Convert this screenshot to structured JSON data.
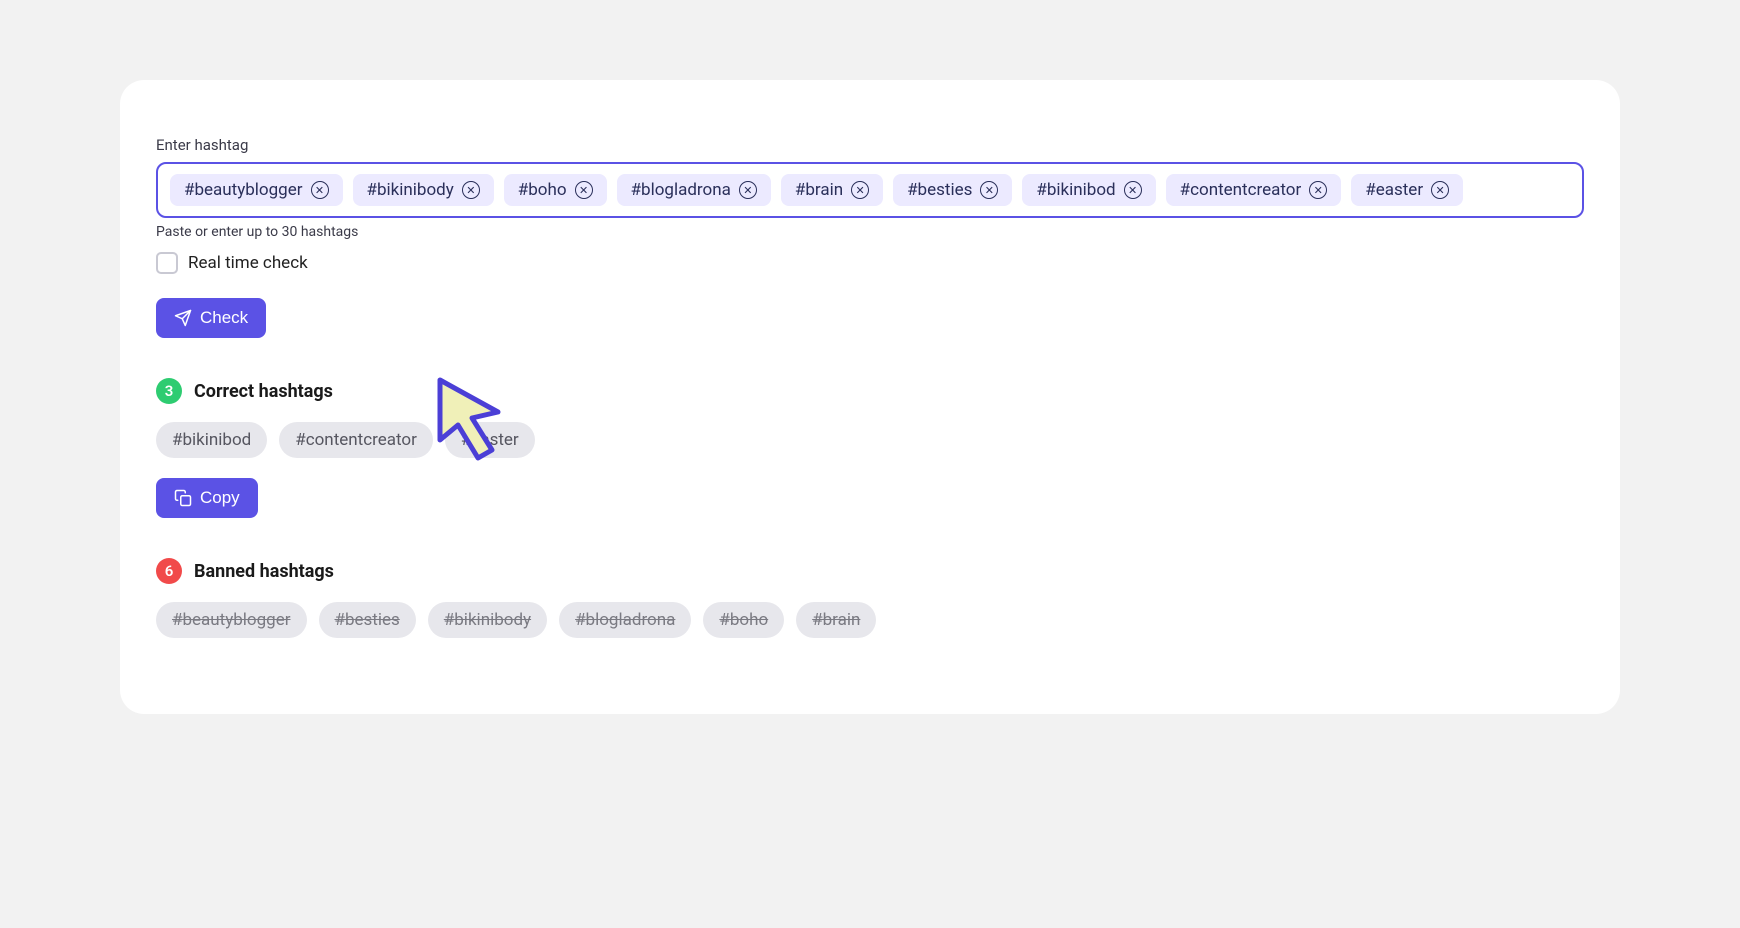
{
  "label": "Enter hashtag",
  "helper": "Paste or enter up to 30 hashtags",
  "inputTags": [
    "#beautyblogger",
    "#bikinibody",
    "#boho",
    "#blogladrona",
    "#brain",
    "#besties",
    "#bikinibod",
    "#contentcreator",
    "#easter"
  ],
  "realTimeCheck": {
    "label": "Real time check",
    "checked": false
  },
  "checkButton": "Check",
  "correct": {
    "count": "3",
    "title": "Correct hashtags",
    "items": [
      "#bikinibod",
      "#contentcreator",
      "#easter"
    ]
  },
  "copyButton": "Copy",
  "banned": {
    "count": "6",
    "title": "Banned hashtags",
    "items": [
      "#beautyblogger",
      "#besties",
      "#bikinibody",
      "#blogladrona",
      "#boho",
      "#brain"
    ]
  },
  "colors": {
    "accent": "#5b52e5",
    "tagBg": "#eceaff",
    "success": "#2ecc71",
    "danger": "#f14a4a"
  }
}
